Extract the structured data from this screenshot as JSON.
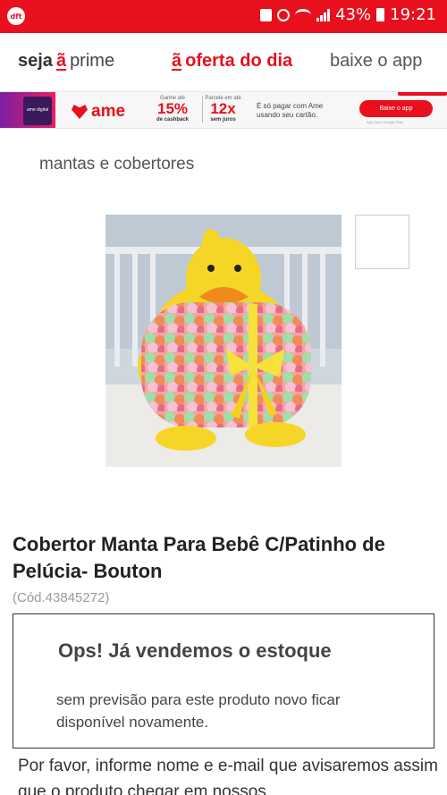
{
  "status_bar": {
    "app_badge": "dft",
    "battery": "43%",
    "time": "19:21"
  },
  "nav": {
    "prime_prefix": "seja",
    "prime_logo": "ã",
    "prime_suffix": "prime",
    "oferta_logo": "ã",
    "oferta_label": "oferta do dia",
    "app_label": "baixe o app"
  },
  "banner": {
    "phone_label": "ame digital",
    "brand": "ame",
    "promo1_small": "Ganhe até",
    "promo1_big": "15%",
    "promo1_sub": "de cashback",
    "promo2_small": "Parcele em até",
    "promo2_big": "12x",
    "promo2_sub": "sem juros",
    "text": "É só pagar com Ame usando seu cartão.",
    "button": "Baixe o app",
    "stores": "App Store   Google Play"
  },
  "breadcrumb": "mantas e cobertores",
  "product": {
    "title": "Cobertor Manta Para Bebê C/Patinho de Pelúcia- Bouton",
    "code": "(Cód.43845272)"
  },
  "stock": {
    "title": "Ops! Já vendemos o estoque",
    "description": "sem previsão para este produto novo ficar disponível novamente."
  },
  "notify": {
    "text": "Por favor, informe nome e e-mail que avisaremos assim que o produto chegar em nossos"
  },
  "colors": {
    "brand_red": "#e8101c",
    "duck_yellow": "#f5d626"
  }
}
